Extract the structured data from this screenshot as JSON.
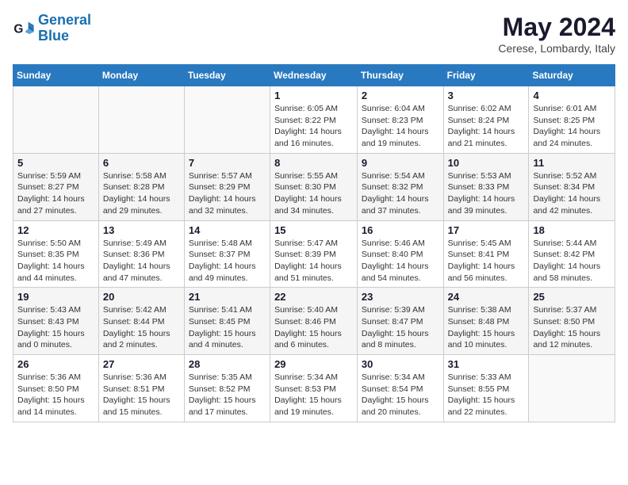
{
  "logo": {
    "line1": "General",
    "line2": "Blue"
  },
  "header": {
    "month": "May 2024",
    "location": "Cerese, Lombardy, Italy"
  },
  "weekdays": [
    "Sunday",
    "Monday",
    "Tuesday",
    "Wednesday",
    "Thursday",
    "Friday",
    "Saturday"
  ],
  "weeks": [
    [
      {
        "day": "",
        "info": ""
      },
      {
        "day": "",
        "info": ""
      },
      {
        "day": "",
        "info": ""
      },
      {
        "day": "1",
        "info": "Sunrise: 6:05 AM\nSunset: 8:22 PM\nDaylight: 14 hours\nand 16 minutes."
      },
      {
        "day": "2",
        "info": "Sunrise: 6:04 AM\nSunset: 8:23 PM\nDaylight: 14 hours\nand 19 minutes."
      },
      {
        "day": "3",
        "info": "Sunrise: 6:02 AM\nSunset: 8:24 PM\nDaylight: 14 hours\nand 21 minutes."
      },
      {
        "day": "4",
        "info": "Sunrise: 6:01 AM\nSunset: 8:25 PM\nDaylight: 14 hours\nand 24 minutes."
      }
    ],
    [
      {
        "day": "5",
        "info": "Sunrise: 5:59 AM\nSunset: 8:27 PM\nDaylight: 14 hours\nand 27 minutes."
      },
      {
        "day": "6",
        "info": "Sunrise: 5:58 AM\nSunset: 8:28 PM\nDaylight: 14 hours\nand 29 minutes."
      },
      {
        "day": "7",
        "info": "Sunrise: 5:57 AM\nSunset: 8:29 PM\nDaylight: 14 hours\nand 32 minutes."
      },
      {
        "day": "8",
        "info": "Sunrise: 5:55 AM\nSunset: 8:30 PM\nDaylight: 14 hours\nand 34 minutes."
      },
      {
        "day": "9",
        "info": "Sunrise: 5:54 AM\nSunset: 8:32 PM\nDaylight: 14 hours\nand 37 minutes."
      },
      {
        "day": "10",
        "info": "Sunrise: 5:53 AM\nSunset: 8:33 PM\nDaylight: 14 hours\nand 39 minutes."
      },
      {
        "day": "11",
        "info": "Sunrise: 5:52 AM\nSunset: 8:34 PM\nDaylight: 14 hours\nand 42 minutes."
      }
    ],
    [
      {
        "day": "12",
        "info": "Sunrise: 5:50 AM\nSunset: 8:35 PM\nDaylight: 14 hours\nand 44 minutes."
      },
      {
        "day": "13",
        "info": "Sunrise: 5:49 AM\nSunset: 8:36 PM\nDaylight: 14 hours\nand 47 minutes."
      },
      {
        "day": "14",
        "info": "Sunrise: 5:48 AM\nSunset: 8:37 PM\nDaylight: 14 hours\nand 49 minutes."
      },
      {
        "day": "15",
        "info": "Sunrise: 5:47 AM\nSunset: 8:39 PM\nDaylight: 14 hours\nand 51 minutes."
      },
      {
        "day": "16",
        "info": "Sunrise: 5:46 AM\nSunset: 8:40 PM\nDaylight: 14 hours\nand 54 minutes."
      },
      {
        "day": "17",
        "info": "Sunrise: 5:45 AM\nSunset: 8:41 PM\nDaylight: 14 hours\nand 56 minutes."
      },
      {
        "day": "18",
        "info": "Sunrise: 5:44 AM\nSunset: 8:42 PM\nDaylight: 14 hours\nand 58 minutes."
      }
    ],
    [
      {
        "day": "19",
        "info": "Sunrise: 5:43 AM\nSunset: 8:43 PM\nDaylight: 15 hours\nand 0 minutes."
      },
      {
        "day": "20",
        "info": "Sunrise: 5:42 AM\nSunset: 8:44 PM\nDaylight: 15 hours\nand 2 minutes."
      },
      {
        "day": "21",
        "info": "Sunrise: 5:41 AM\nSunset: 8:45 PM\nDaylight: 15 hours\nand 4 minutes."
      },
      {
        "day": "22",
        "info": "Sunrise: 5:40 AM\nSunset: 8:46 PM\nDaylight: 15 hours\nand 6 minutes."
      },
      {
        "day": "23",
        "info": "Sunrise: 5:39 AM\nSunset: 8:47 PM\nDaylight: 15 hours\nand 8 minutes."
      },
      {
        "day": "24",
        "info": "Sunrise: 5:38 AM\nSunset: 8:48 PM\nDaylight: 15 hours\nand 10 minutes."
      },
      {
        "day": "25",
        "info": "Sunrise: 5:37 AM\nSunset: 8:50 PM\nDaylight: 15 hours\nand 12 minutes."
      }
    ],
    [
      {
        "day": "26",
        "info": "Sunrise: 5:36 AM\nSunset: 8:50 PM\nDaylight: 15 hours\nand 14 minutes."
      },
      {
        "day": "27",
        "info": "Sunrise: 5:36 AM\nSunset: 8:51 PM\nDaylight: 15 hours\nand 15 minutes."
      },
      {
        "day": "28",
        "info": "Sunrise: 5:35 AM\nSunset: 8:52 PM\nDaylight: 15 hours\nand 17 minutes."
      },
      {
        "day": "29",
        "info": "Sunrise: 5:34 AM\nSunset: 8:53 PM\nDaylight: 15 hours\nand 19 minutes."
      },
      {
        "day": "30",
        "info": "Sunrise: 5:34 AM\nSunset: 8:54 PM\nDaylight: 15 hours\nand 20 minutes."
      },
      {
        "day": "31",
        "info": "Sunrise: 5:33 AM\nSunset: 8:55 PM\nDaylight: 15 hours\nand 22 minutes."
      },
      {
        "day": "",
        "info": ""
      }
    ]
  ]
}
